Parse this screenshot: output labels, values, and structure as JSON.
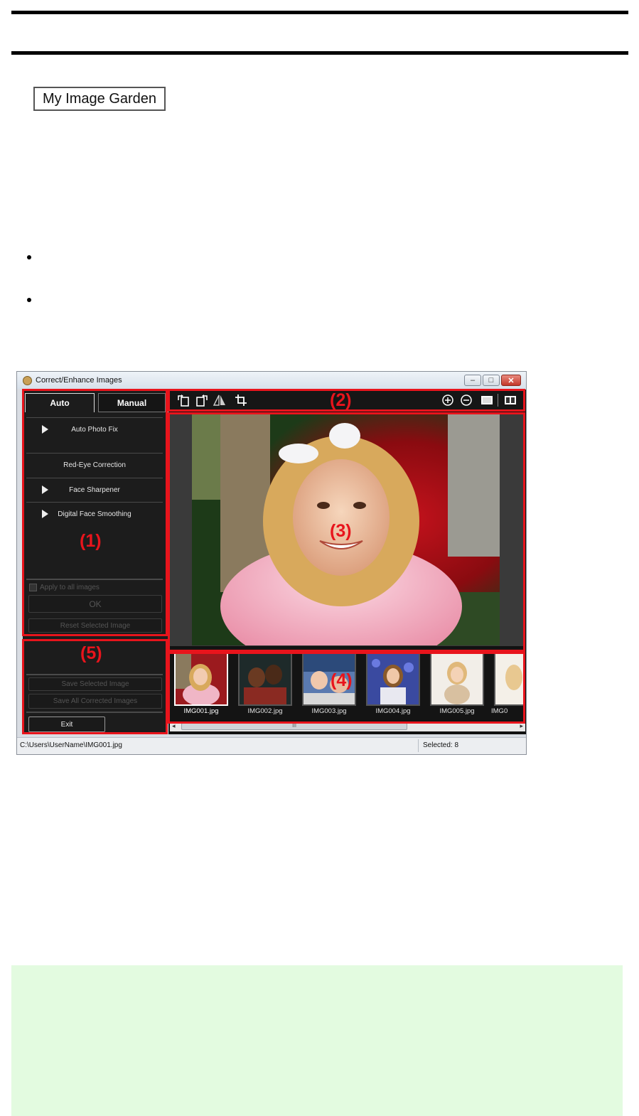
{
  "page": {
    "badge_label": "My Image Garden"
  },
  "window": {
    "title": "Correct/Enhance Images",
    "controls": {
      "minimize": "–",
      "maximize": "□",
      "close": "✕"
    },
    "tabs": {
      "auto": "Auto",
      "manual": "Manual"
    },
    "auto_menu": [
      {
        "label": "Auto Photo Fix",
        "expandable": true
      },
      {
        "label": "Red-Eye Correction",
        "expandable": false
      },
      {
        "label": "Face Sharpener",
        "expandable": true
      },
      {
        "label": "Digital Face Smoothing",
        "expandable": true
      }
    ],
    "apply_all_label": "Apply to all images",
    "ok_label": "OK",
    "reset_label": "Reset Selected Image",
    "save_selected_label": "Save Selected Image",
    "save_all_label": "Save All Corrected Images",
    "exit_label": "Exit",
    "toolbar_icons": [
      "rotate-left-icon",
      "rotate-right-icon",
      "flip-horizontal-icon",
      "crop-icon",
      "zoom-in-icon",
      "zoom-out-icon",
      "whole-image-icon",
      "compare-icon"
    ],
    "thumbnails": [
      {
        "label": "IMG001.jpg",
        "selected": true
      },
      {
        "label": "IMG002.jpg",
        "selected": false
      },
      {
        "label": "IMG003.jpg",
        "selected": false
      },
      {
        "label": "IMG004.jpg",
        "selected": false
      },
      {
        "label": "IMG005.jpg",
        "selected": false
      },
      {
        "label": "IMG0",
        "selected": false
      }
    ],
    "scroll_thumb_mark": "III",
    "status_path": "C:\\Users\\UserName\\IMG001.jpg",
    "status_selected": "Selected: 8"
  },
  "region_labels": {
    "r1": "(1)",
    "r2": "(2)",
    "r3": "(3)",
    "r4": "(4)",
    "r5": "(5)"
  },
  "colors": {
    "callout_red": "#e8141c",
    "panel_dark": "#1c1c1c",
    "note_bg": "#e3fbe0"
  }
}
